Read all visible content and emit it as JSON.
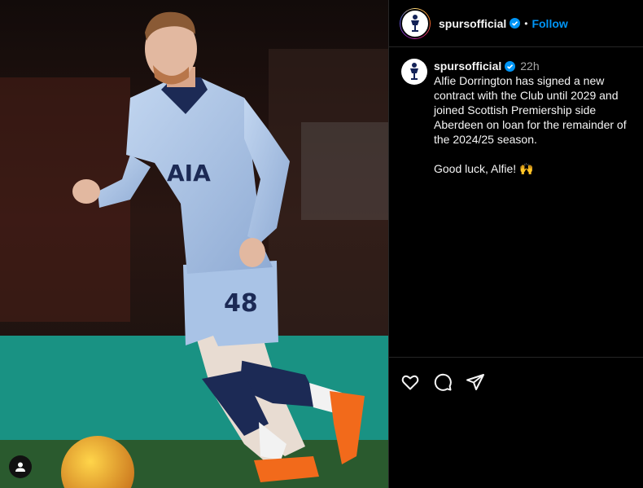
{
  "header": {
    "username": "spursofficial",
    "separator": "•",
    "follow_label": "Follow"
  },
  "caption": {
    "username": "spursofficial",
    "time": "22h",
    "text": "Alfie Dorrington has signed a new contract with the Club until 2029 and joined Scottish Premiership side Aberdeen on loan for the remainder of the 2024/25 season.\n\nGood luck, Alfie! 🙌"
  },
  "photo": {
    "shirt_sponsor": "AIA",
    "shirt_number": "48"
  },
  "icons": [
    "verified-badge-icon",
    "heart-icon",
    "comment-icon",
    "share-icon",
    "user-tag-icon",
    "club-crest-icon"
  ],
  "colors": {
    "accent_blue": "#0095f6",
    "background": "#000000",
    "kit_blue": "#a9c3e6",
    "kit_navy": "#1c2a55",
    "boots_orange": "#f26a1b"
  }
}
